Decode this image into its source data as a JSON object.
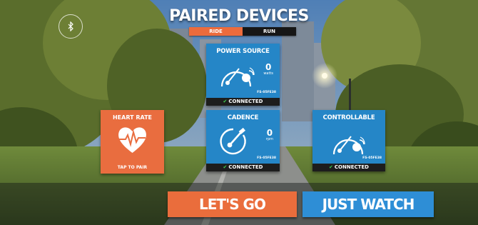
{
  "header": {
    "title": "PAIRED DEVICES",
    "tabs": [
      {
        "label": "RIDE",
        "active": true
      },
      {
        "label": "RUN",
        "active": false
      }
    ]
  },
  "bluetooth": {
    "icon": "bluetooth-icon"
  },
  "tiles": {
    "power": {
      "name": "POWER SOURCE",
      "value": "0",
      "unit": "watts",
      "sensor_id": "FS-05FE38",
      "status": "CONNECTED",
      "icon": "power-meter-icon"
    },
    "heart": {
      "name": "HEART RATE",
      "action": "TAP TO PAIR",
      "icon": "heart-pulse-icon"
    },
    "cadence": {
      "name": "CADENCE",
      "value": "0",
      "unit": "rpm",
      "sensor_id": "FS-05FE38",
      "status": "CONNECTED",
      "icon": "cadence-crank-icon"
    },
    "controllable": {
      "name": "CONTROLLABLE",
      "sensor_id": "FS-05FE38",
      "status": "CONNECTED",
      "icon": "trainer-icon"
    }
  },
  "actions": {
    "lets_go": "LET'S GO",
    "just_watch": "JUST WATCH"
  },
  "colors": {
    "accent_orange": "#ea6d3c",
    "tile_blue": "#2586c7",
    "connected_green": "#3fcf4f"
  }
}
